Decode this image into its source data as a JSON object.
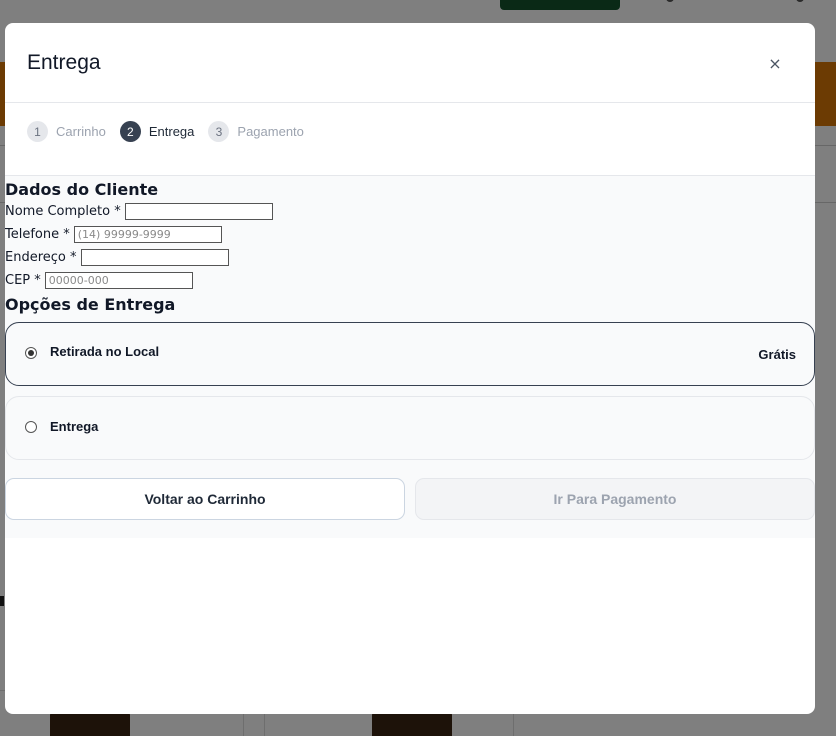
{
  "modal": {
    "title": "Entrega",
    "close_glyph": "×"
  },
  "steps": [
    {
      "num": "1",
      "label": "Carrinho",
      "active": false
    },
    {
      "num": "2",
      "label": "Entrega",
      "active": true
    },
    {
      "num": "3",
      "label": "Pagamento",
      "active": false
    }
  ],
  "customer": {
    "title": "Dados do Cliente",
    "name": {
      "label": "Nome Completo *",
      "value": "",
      "placeholder": ""
    },
    "phone": {
      "label": "Telefone *",
      "value": "",
      "placeholder": "(14) 99999-9999"
    },
    "address": {
      "label": "Endereço *",
      "value": "",
      "placeholder": ""
    },
    "cep": {
      "label": "CEP *",
      "value": "",
      "placeholder": "00000-000"
    }
  },
  "delivery": {
    "title": "Opções de Entrega",
    "options": [
      {
        "label": "Retirada no Local",
        "price": "Grátis",
        "selected": true
      },
      {
        "label": "Entrega",
        "price": "",
        "selected": false
      }
    ]
  },
  "buttons": {
    "back": "Voltar ao Carrinho",
    "next": "Ir Para Pagamento"
  },
  "icons": {
    "close": "close-icon",
    "radio_on": "radio-selected-icon",
    "radio_off": "radio-unselected-icon"
  },
  "colors": {
    "active_step": "#374151",
    "selected_border": "#374151",
    "backdrop_banner": "#d97706"
  }
}
